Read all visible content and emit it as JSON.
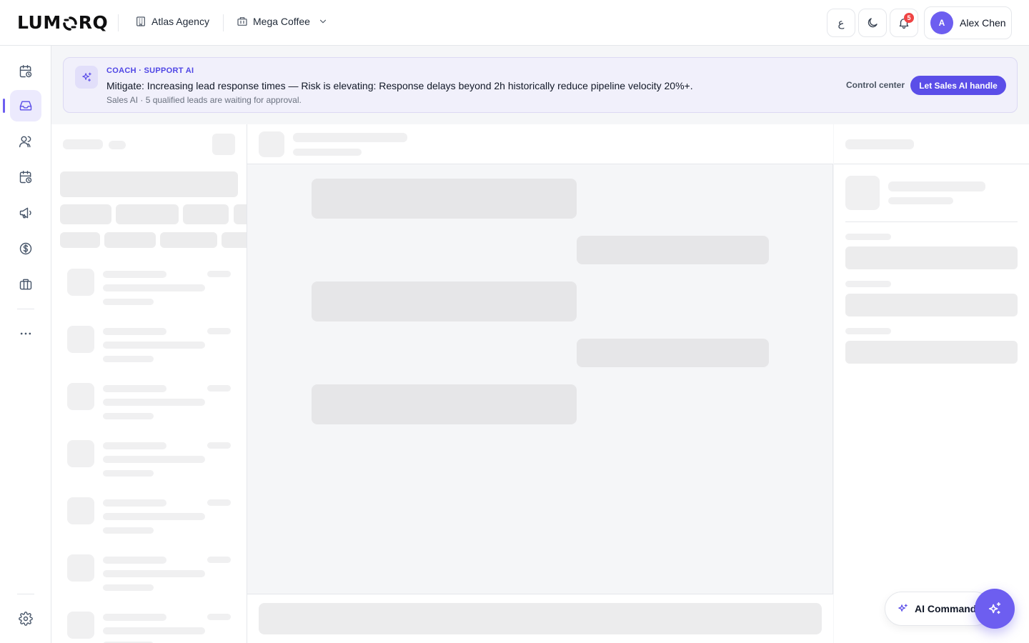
{
  "brand": {
    "logo_text_left": "LUM",
    "logo_text_right": "RQ",
    "logo_mark": "lumorq-o-mark"
  },
  "header": {
    "agency": {
      "label": "Atlas Agency",
      "icon": "building-icon"
    },
    "workspace": {
      "label": "Mega Coffee",
      "icon": "store-icon",
      "chevron": "chevron-down-icon"
    },
    "language_button": "ع",
    "theme_icon": "moon-icon",
    "notifications": {
      "icon": "bell-icon",
      "count": "5"
    },
    "user": {
      "initial": "A",
      "name": "Alex Chen"
    }
  },
  "sidebar": {
    "items": [
      {
        "icon": "calendar-clock-icon",
        "active": false
      },
      {
        "icon": "inbox-icon",
        "active": true
      },
      {
        "icon": "users-icon",
        "active": false
      },
      {
        "icon": "calendar-clock-icon",
        "active": false
      },
      {
        "icon": "megaphone-icon",
        "active": false
      },
      {
        "icon": "dollar-circle-icon",
        "active": false
      },
      {
        "icon": "briefcase-icon",
        "active": false
      },
      {
        "icon": "more-dots-icon",
        "active": false
      }
    ],
    "bottom_icon": "settings-gear-icon"
  },
  "coach_banner": {
    "icon": "sparkles-icon",
    "eyebrow": "COACH · SUPPORT AI",
    "title": "Mitigate: Increasing lead response times — Risk is elevating: Response delays beyond 2h historically reduce pipeline velocity 20%+.",
    "subtitle": "Sales AI · 5 qualified leads are waiting for approval.",
    "link_label": "Control center",
    "cta_label": "Let Sales AI handle"
  },
  "ai_command": {
    "label": "AI Command",
    "icon": "sparkles-icon",
    "fab_icon": "sparkles-icon"
  },
  "colors": {
    "accent": "#6d5ef0",
    "accent_dark": "#5b4ee8",
    "badge": "#ef4444",
    "banner_bg": "#f1f0fb",
    "skeleton": "#ececed"
  },
  "state": {
    "loading": "skeleton placeholders shown in conversation list, thread and details panels"
  }
}
